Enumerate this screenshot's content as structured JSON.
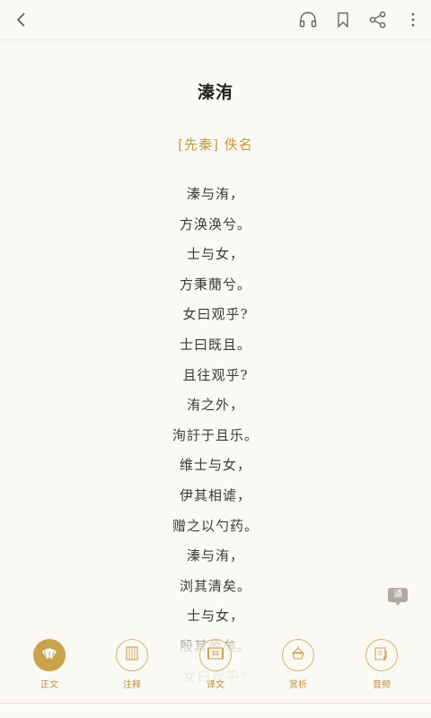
{
  "poem": {
    "title": "溱洧",
    "author": "[先秦] 佚名",
    "lines": [
      "溱与洧，",
      "方涣涣兮。",
      "士与女，",
      "方秉蕑兮。",
      "女曰观乎?",
      "士曰既且。",
      "且往观乎?",
      "洧之外，",
      "洵訏于且乐。",
      "维士与女，",
      "伊其相谑，",
      "赠之以勺药。",
      "溱与洧，",
      "浏其清矣。",
      "士与女，",
      "殷其盈矣。",
      "女曰观乎?"
    ]
  },
  "recite_badge": "诵",
  "bottom_nav": [
    {
      "label": "正文",
      "icon": "fan-icon",
      "active": true
    },
    {
      "label": "注释",
      "icon": "book-icon",
      "active": false
    },
    {
      "label": "译文",
      "icon": "scroll-icon",
      "active": false
    },
    {
      "label": "赏析",
      "icon": "teapot-icon",
      "active": false
    },
    {
      "label": "音频",
      "icon": "music-note-icon",
      "active": false
    }
  ],
  "colors": {
    "background": "#fbf9f4",
    "accent": "#c9a24c",
    "author": "#c09a45"
  }
}
